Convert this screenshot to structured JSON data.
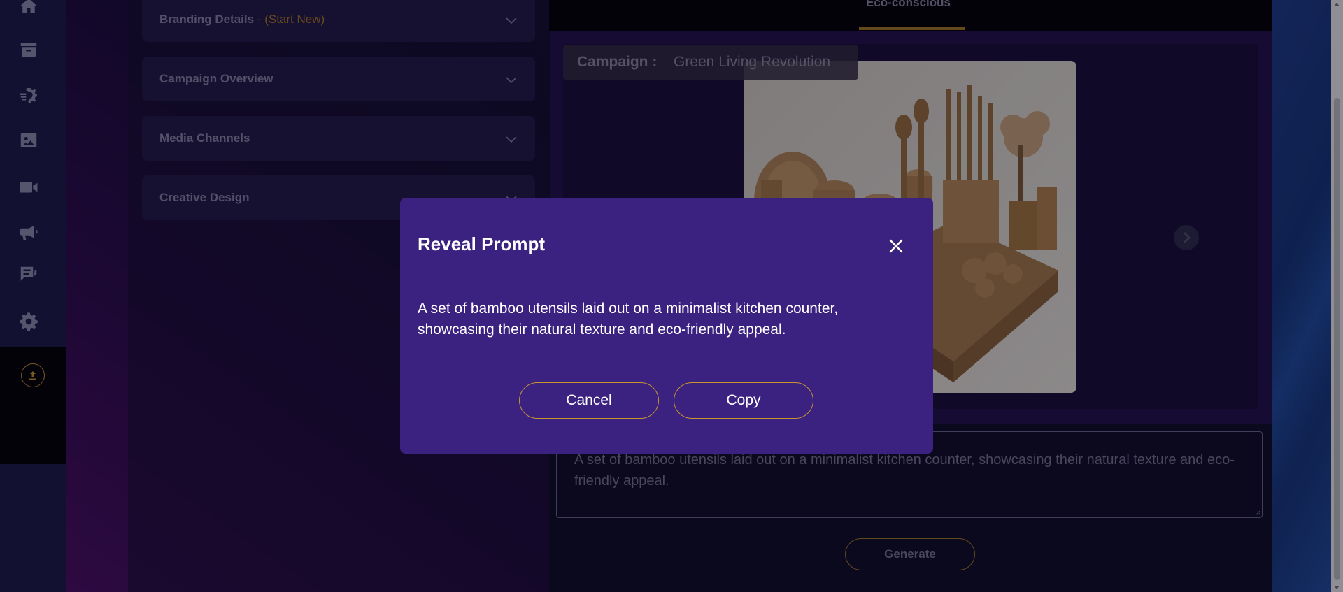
{
  "sidebar": {
    "icons": [
      "home-icon",
      "archive-icon",
      "brand-settings-icon",
      "image-icon",
      "video-icon",
      "megaphone-icon",
      "feedback-icon",
      "settings-icon"
    ],
    "upload_icon": "upload-icon"
  },
  "accordions": [
    {
      "title": "Branding Details",
      "suffix": " - (Start New)"
    },
    {
      "title": "Campaign Overview",
      "suffix": ""
    },
    {
      "title": "Media Channels",
      "suffix": ""
    },
    {
      "title": "Creative Design",
      "suffix": ""
    }
  ],
  "tabs": {
    "active_label": "Eco-conscious"
  },
  "campaign": {
    "label": "Campaign :",
    "value": "Green Living Revolution"
  },
  "prompt_field": {
    "value": "A set of bamboo utensils laid out on a minimalist kitchen counter, showcasing their natural texture and eco-friendly appeal."
  },
  "generate_button": {
    "label": "Generate"
  },
  "modal": {
    "title": "Reveal Prompt",
    "body": "A set of bamboo utensils laid out on a minimalist kitchen counter, showcasing their natural texture and eco-friendly appeal.",
    "cancel_label": "Cancel",
    "copy_label": "Copy"
  },
  "colors": {
    "accent_gold": "#c9962e",
    "modal_bg": "#3b2280",
    "sidebar_bg": "#1b1b47"
  }
}
